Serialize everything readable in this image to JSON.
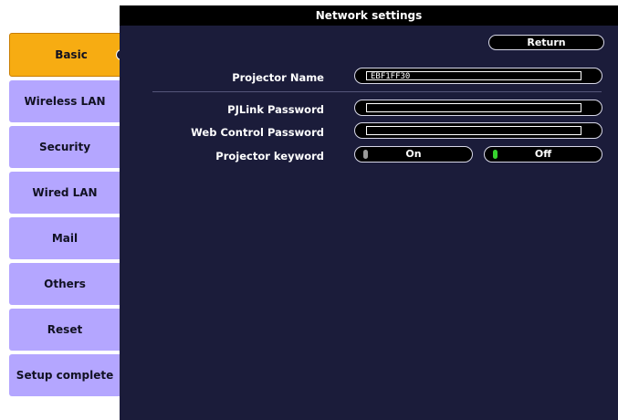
{
  "window": {
    "title": "Network settings"
  },
  "sidebar": {
    "tabs": [
      {
        "label": "Basic",
        "active": true
      },
      {
        "label": "Wireless LAN"
      },
      {
        "label": "Security"
      },
      {
        "label": "Wired LAN"
      },
      {
        "label": "Mail"
      },
      {
        "label": "Others"
      },
      {
        "label": "Reset"
      },
      {
        "label": "Setup complete"
      }
    ]
  },
  "form": {
    "return_label": "Return",
    "projector_name": {
      "label": "Projector Name",
      "value": "EBF1FF30"
    },
    "pjlink_password": {
      "label": "PJLink Password",
      "value": ""
    },
    "web_control_password": {
      "label": "Web Control Password",
      "value": ""
    },
    "projector_keyword": {
      "label": "Projector keyword",
      "on_label": "On",
      "off_label": "Off",
      "selected": "Off"
    }
  },
  "colors": {
    "panel": "#1b1c3a",
    "tab": "#b4a6ff",
    "active_tab": "#f7ac12",
    "selected_indicator": "#36d12e"
  }
}
